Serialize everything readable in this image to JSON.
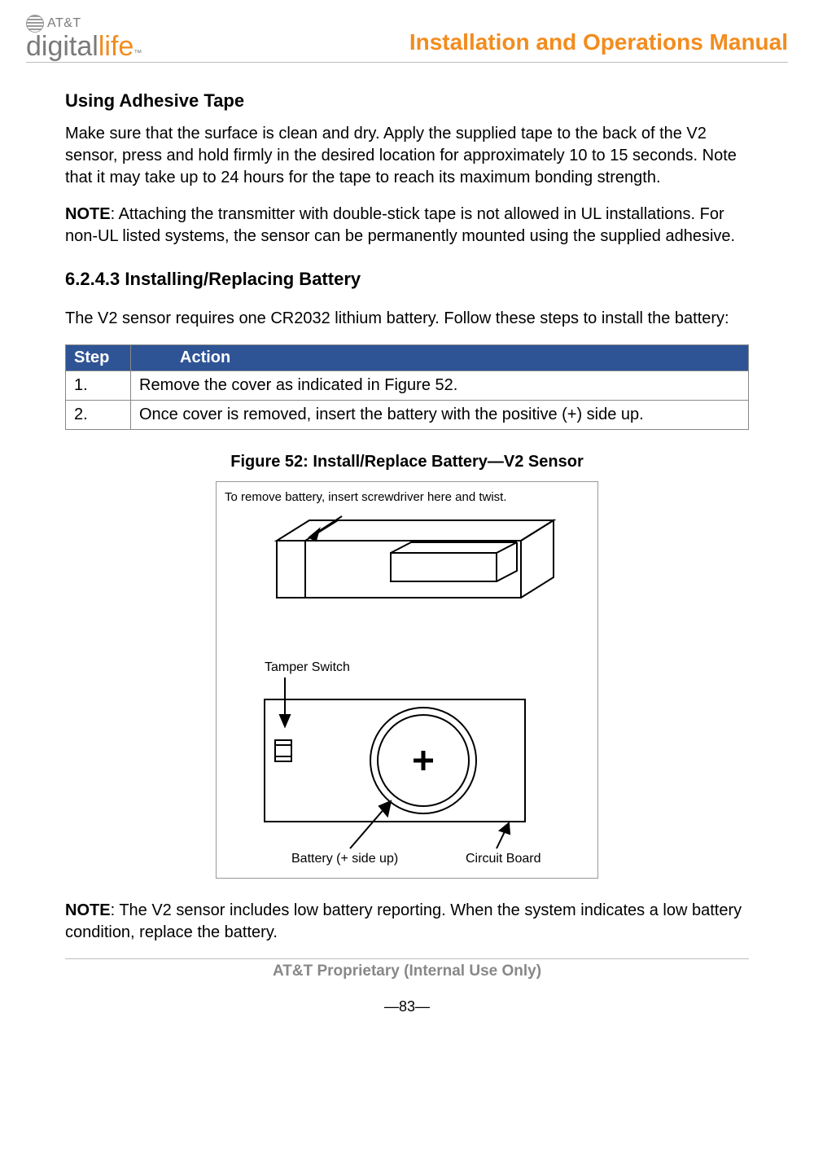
{
  "header": {
    "brand_top": "AT&T",
    "brand_main_a": "digital",
    "brand_main_b": "life",
    "tm": "™",
    "doc_title": "Installation and Operations Manual"
  },
  "section1": {
    "heading": "Using Adhesive Tape",
    "para": "Make sure that the surface is clean and dry. Apply the supplied tape to the back of the V2 sensor, press and hold firmly in the desired location for approximately 10 to 15 seconds. Note that it may take up to 24 hours for the tape to reach its maximum bonding strength.",
    "note_label": "NOTE",
    "note_text": ": Attaching the transmitter with double-stick tape is not allowed in UL installations. For non-UL listed systems, the sensor can be permanently mounted using the supplied adhesive."
  },
  "section2": {
    "heading": "6.2.4.3  Installing/Replacing Battery",
    "intro": "The V2 sensor requires one CR2032 lithium battery. Follow these steps to install the battery:",
    "table": {
      "th_step": "Step",
      "th_action": "Action",
      "rows": [
        {
          "step": "1.",
          "action": "Remove the cover as indicated in Figure 52."
        },
        {
          "step": "2.",
          "action": "Once cover is removed, insert the battery with the positive (+) side up."
        }
      ]
    },
    "figure_caption": "Figure 52:  Install/Replace Battery—V2 Sensor",
    "figure_labels": {
      "top_instruction": "To remove battery, insert screwdriver here and twist.",
      "tamper": "Tamper Switch",
      "battery": "Battery (+ side up)",
      "board": "Circuit Board"
    },
    "note2_label": "NOTE",
    "note2_text": ": The V2 sensor includes low battery reporting. When the system indicates a low battery condition, replace the battery."
  },
  "footer": {
    "proprietary": "AT&T Proprietary (Internal Use Only)",
    "page": "—83—"
  }
}
